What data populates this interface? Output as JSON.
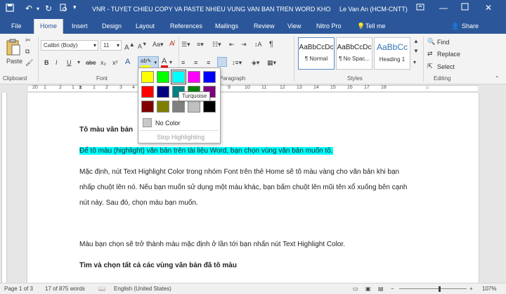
{
  "titlebar": {
    "title": "VNR - TUYET CHIEU COPY VA PASTE NHIEU VUNG VAN BAN TREN WORD KHONG...",
    "user": "Le Van An (HCM-CNTT)"
  },
  "tabs": [
    {
      "label": "File"
    },
    {
      "label": "Home"
    },
    {
      "label": "Insert"
    },
    {
      "label": "Design"
    },
    {
      "label": "Layout"
    },
    {
      "label": "References"
    },
    {
      "label": "Mailings"
    },
    {
      "label": "Review"
    },
    {
      "label": "View"
    },
    {
      "label": "Nitro Pro"
    },
    {
      "label": "Tell me"
    }
  ],
  "share_label": "Share",
  "ribbon": {
    "clipboard": {
      "paste": "Paste",
      "group": "Clipboard"
    },
    "font": {
      "name": "Calibri (Body)",
      "size": "11",
      "group": "Font",
      "bold": "B",
      "italic": "I",
      "underline": "U"
    },
    "paragraph": {
      "group": "Paragraph"
    },
    "styles": {
      "group": "Styles",
      "items": [
        {
          "preview": "AaBbCcDc",
          "name": "¶ Normal"
        },
        {
          "preview": "AaBbCcDc",
          "name": "¶ No Spac..."
        },
        {
          "preview": "AaBbCc",
          "name": "Heading 1"
        }
      ]
    },
    "editing": {
      "group": "Editing",
      "find": "Find",
      "replace": "Replace",
      "select": "Select"
    }
  },
  "ruler": {
    "labels": [
      "20",
      "1",
      "2",
      "1",
      "1",
      "2",
      "3",
      "4",
      "5",
      "6",
      "7",
      "8",
      "9",
      "10",
      "11",
      "12",
      "13",
      "14",
      "15",
      "16",
      "17",
      "18"
    ]
  },
  "document": {
    "heading1": "Tô màu văn bản",
    "highlighted": "Để tô màu (highlight) văn bản trên tài liệu Word, bạn chọn vùng văn bản muốn tô.",
    "para1_l1": "Mặc định, nút Text Highlight Color trong nhóm Font trên thẻ Home sẽ tô màu vàng cho văn bản khi bạn",
    "para1_l2": "nhấp chuột lên nó. Nếu bạn muốn sử dụng một màu khác, bạn bấm chuột lên mũi tên xổ xuống bên cạnh",
    "para1_l3": "nút này. Sau đó, chọn màu bạn muốn.",
    "para2": "Màu bạn chọn sẽ trở thành màu mặc định ở lần tới bạn nhấn nút Text Highlight Color.",
    "heading2": "Tìm và chọn tất cả các vùng văn bản đã tô màu"
  },
  "highlight_menu": {
    "swatches": [
      "#ffff00",
      "#00ff00",
      "#00ffff",
      "#ff00ff",
      "#0000ff",
      "#ff0000",
      "#000080",
      "#008080",
      "#008000",
      "#800080",
      "#800000",
      "#808000",
      "#808080",
      "#c0c0c0",
      "#000000"
    ],
    "selected_index": 2,
    "no_color": "No Color",
    "stop": "Stop Highlighting",
    "tooltip": "Turquoise"
  },
  "status": {
    "page": "Page 1 of 3",
    "words": "17 of 875 words",
    "language": "English (United States)",
    "zoom": "107%"
  },
  "colors": {
    "accent": "#2b579a",
    "highlight": "#00ffff"
  }
}
